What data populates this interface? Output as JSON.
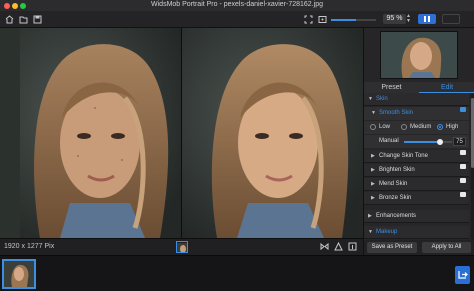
{
  "window": {
    "title": "WidsMob Portrait Pro - pexels-daniel-xavier-728162.jpg"
  },
  "toolbar": {
    "zoom_value": "95 %",
    "zoom_fraction": 0.55
  },
  "status": {
    "dimensions": "1920 x 1277 Pix"
  },
  "panel": {
    "tabs": [
      "Preset",
      "Edit"
    ],
    "active_tab": "Edit",
    "sections": {
      "skin": "Skin",
      "smooth_skin": "Smooth Skin",
      "level_options": [
        "Low",
        "Medium",
        "High"
      ],
      "level_selected": "High",
      "manual_label": "Manual",
      "manual_value": "75",
      "change_skin_tone": "Change Skin Tone",
      "brighten_skin": "Brighten Skin",
      "mend_skin": "Mend Skin",
      "bronze_skin": "Bronze Skin",
      "enhancements": "Enhancements",
      "makeup": "Makeup"
    },
    "buttons": {
      "save_preset": "Save as Preset",
      "apply_all": "Apply to All"
    }
  },
  "colors": {
    "accent": "#3b8ee0",
    "background": "#1b1b1e",
    "panel": "#262629"
  }
}
